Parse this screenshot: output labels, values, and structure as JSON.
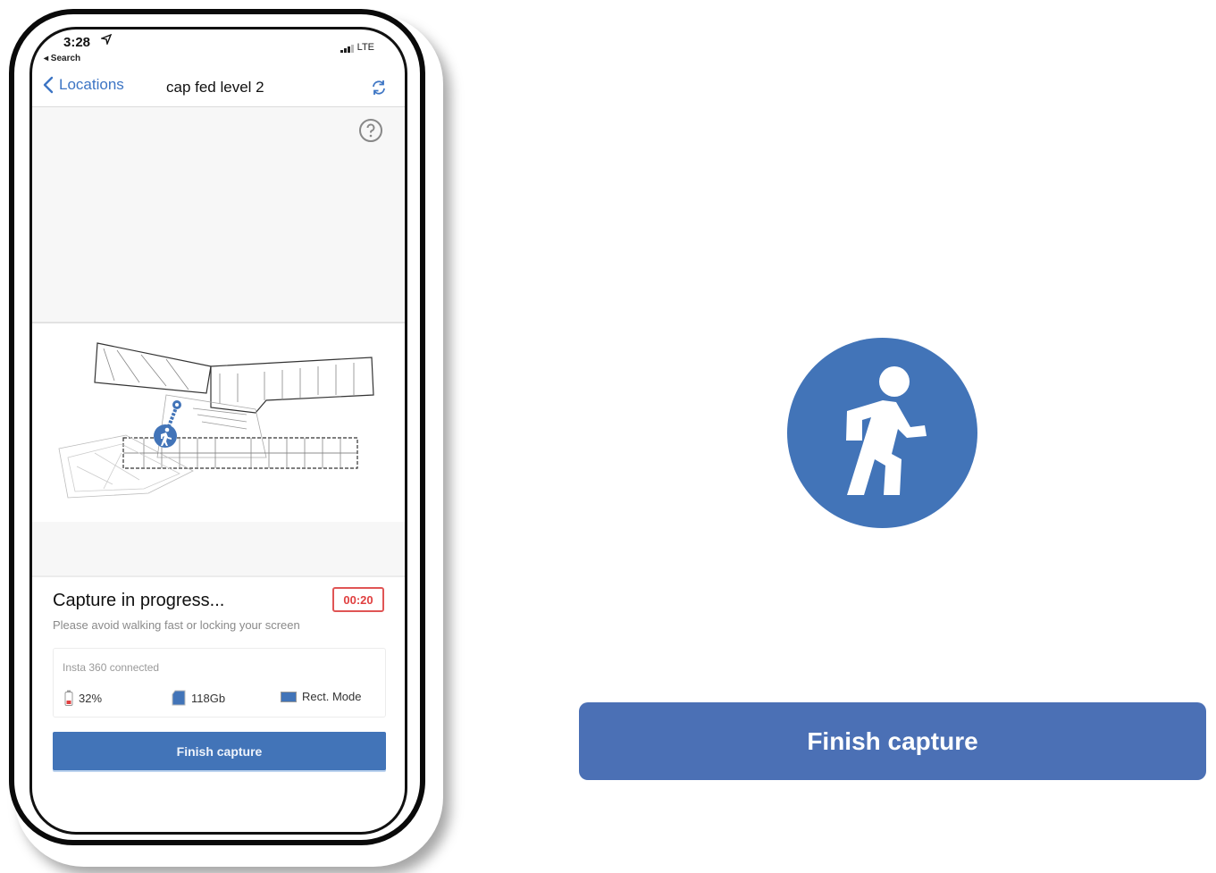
{
  "status_bar": {
    "time": "3:28",
    "location_icon": "location-arrow-icon",
    "back_label": "◂ Search",
    "network": "LTE"
  },
  "nav": {
    "back_label": "Locations",
    "title": "cap fed level 2",
    "refresh_icon": "refresh-icon"
  },
  "map": {
    "help_icon": "question-circle-icon",
    "marker_icon": "walking-person-icon"
  },
  "capture": {
    "title": "Capture in progress...",
    "timer": "00:20",
    "subtitle": "Please avoid walking fast or locking your screen",
    "device_name": "Insta 360 connected",
    "battery": "32%",
    "storage": "118Gb",
    "mode": "Rect. Mode",
    "finish_label": "Finish capture"
  },
  "callout": {
    "icon": "walking-person-icon",
    "finish_label": "Finish capture"
  },
  "colors": {
    "accent": "#4274b8",
    "link": "#3d75c4",
    "timer": "#e04040",
    "big_button": "#4b70b5"
  }
}
